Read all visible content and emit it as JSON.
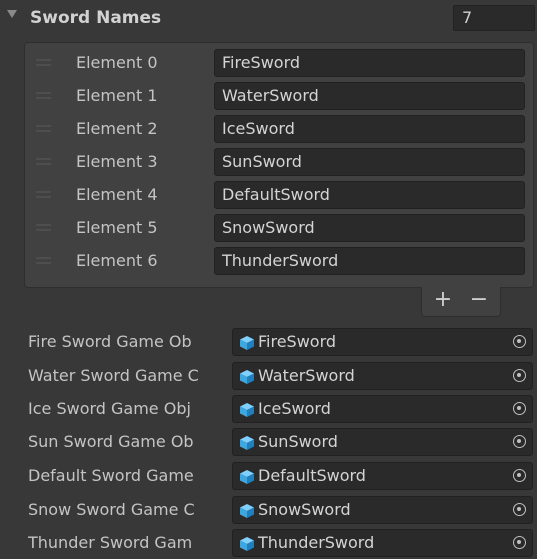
{
  "header": {
    "title": "Sword Names",
    "count": "7"
  },
  "elements": [
    {
      "label": "Element 0",
      "value": "FireSword"
    },
    {
      "label": "Element 1",
      "value": "WaterSword"
    },
    {
      "label": "Element 2",
      "value": "IceSword"
    },
    {
      "label": "Element 3",
      "value": "SunSword"
    },
    {
      "label": "Element 4",
      "value": "DefaultSword"
    },
    {
      "label": "Element 5",
      "value": "SnowSword"
    },
    {
      "label": "Element 6",
      "value": "ThunderSword"
    }
  ],
  "footer": {
    "add": "+",
    "remove": "−"
  },
  "objects": [
    {
      "label": "Fire Sword Game Ob",
      "value": "FireSword"
    },
    {
      "label": "Water Sword Game C",
      "value": "WaterSword"
    },
    {
      "label": "Ice Sword Game Obj",
      "value": "IceSword"
    },
    {
      "label": "Sun Sword Game Ob",
      "value": "SunSword"
    },
    {
      "label": "Default Sword Game",
      "value": "DefaultSword"
    },
    {
      "label": "Snow Sword Game C",
      "value": "SnowSword"
    },
    {
      "label": "Thunder Sword Gam",
      "value": "ThunderSword"
    }
  ],
  "colors": {
    "accent_icon": "#3fa7e0",
    "field_bg": "#2a2a2a",
    "panel_bg": "#383838"
  },
  "icons": {
    "object": "prefab-cube-icon",
    "picker": "object-picker-icon"
  }
}
